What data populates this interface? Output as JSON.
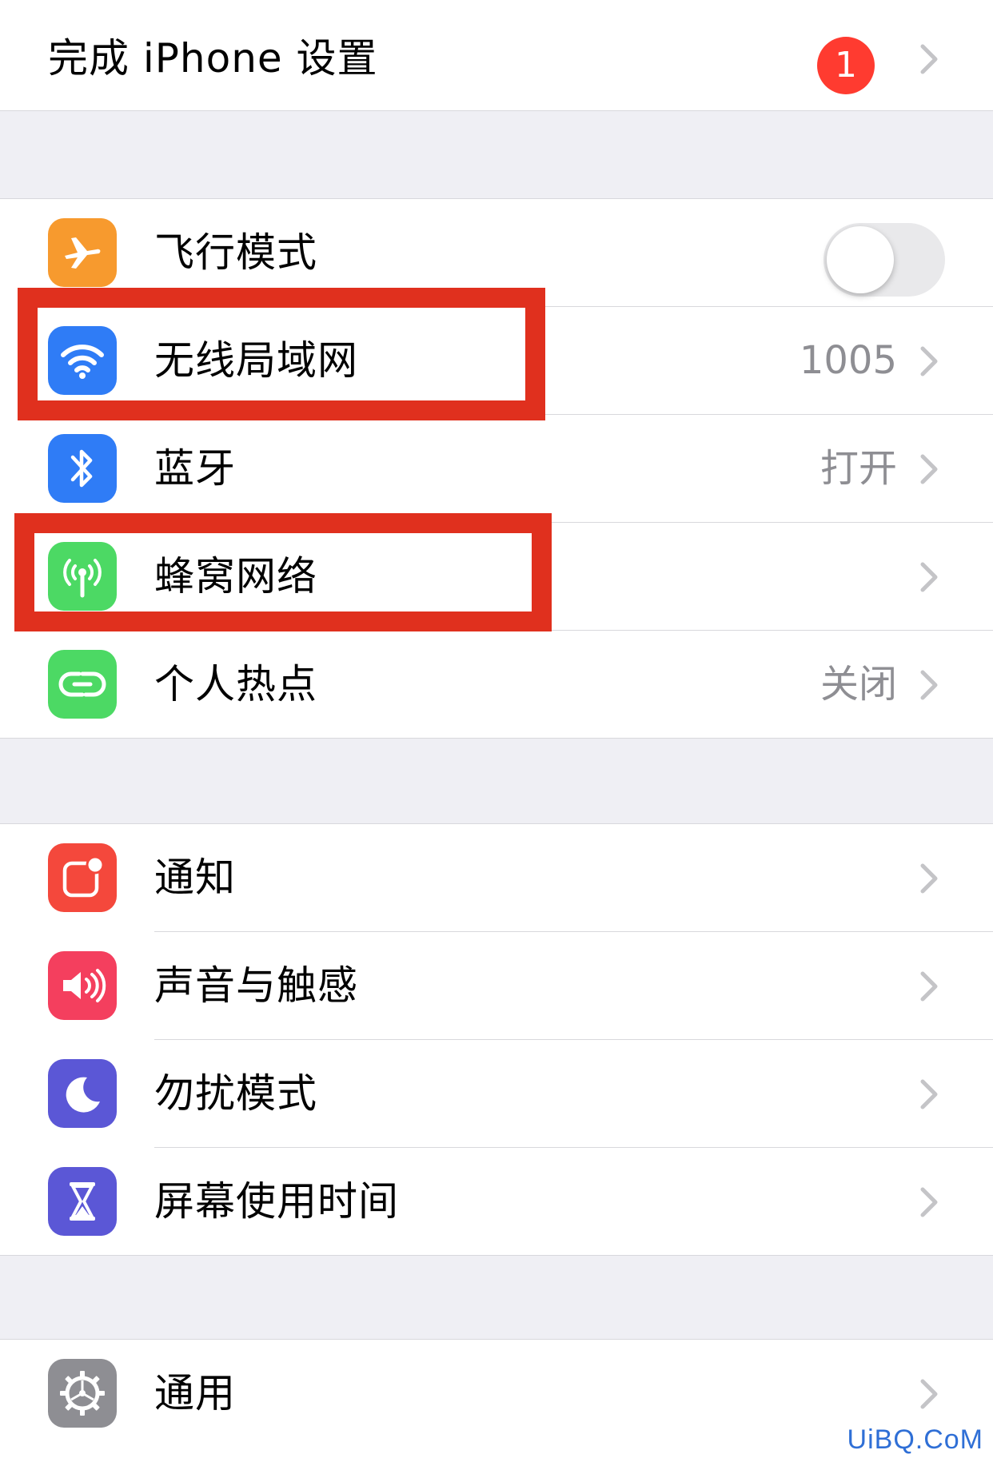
{
  "colors": {
    "background": "#efeff4",
    "chevron": "#c4c4c7",
    "secondary_text": "#8e8e93",
    "badge": "#ff3b30",
    "highlight_box": "#e0301e",
    "watermark": "#2f6fd6"
  },
  "setup": {
    "label": "完成 iPhone 设置",
    "badge": "1"
  },
  "connectivity": {
    "airplane": {
      "label": "飞行模式",
      "icon": "airplane-icon",
      "icon_bg": "#f79a2e",
      "toggle_on": false
    },
    "wifi": {
      "label": "无线局域网",
      "value": "1005",
      "icon": "wifi-icon",
      "icon_bg": "#2f7cf6"
    },
    "bluetooth": {
      "label": "蓝牙",
      "value": "打开",
      "icon": "bluetooth-icon",
      "icon_bg": "#2f7cf6"
    },
    "cellular": {
      "label": "蜂窝网络",
      "icon": "cellular-antenna-icon",
      "icon_bg": "#4cd964"
    },
    "hotspot": {
      "label": "个人热点",
      "value": "关闭",
      "icon": "hotspot-link-icon",
      "icon_bg": "#4cd964"
    }
  },
  "notifications_group": {
    "notifications": {
      "label": "通知",
      "icon": "notifications-icon",
      "icon_bg": "#f4483c"
    },
    "sounds": {
      "label": "声音与触感",
      "icon": "speaker-icon",
      "icon_bg": "#f43f5e"
    },
    "dnd": {
      "label": "勿扰模式",
      "icon": "moon-icon",
      "icon_bg": "#5b57d6"
    },
    "screen_time": {
      "label": "屏幕使用时间",
      "icon": "hourglass-icon",
      "icon_bg": "#5b57d6"
    }
  },
  "general_group": {
    "general": {
      "label": "通用",
      "icon": "gear-icon",
      "icon_bg": "#8e8e93"
    }
  },
  "watermark": "UiBQ.CoM"
}
